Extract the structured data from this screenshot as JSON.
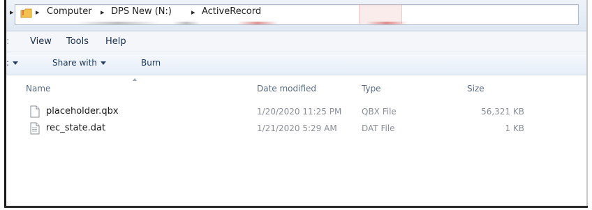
{
  "address_bar": {
    "crumbs": [
      "Computer",
      "DPS New (N:)",
      "ActiveRecord"
    ]
  },
  "menu": {
    "items": [
      "View",
      "Tools",
      "Help"
    ]
  },
  "toolbar": {
    "share_label": "Share with",
    "burn_label": "Burn"
  },
  "columns": {
    "name": "Name",
    "date": "Date modified",
    "type": "Type",
    "size": "Size"
  },
  "files": [
    {
      "name": "placeholder.qbx",
      "date": "1/20/2020 11:25 PM",
      "type": "QBX File",
      "size": "56,321 KB",
      "icon": "blank-file-icon"
    },
    {
      "name": "rec_state.dat",
      "date": "1/21/2020 5:29 AM",
      "type": "DAT File",
      "size": "1 KB",
      "icon": "text-file-icon"
    }
  ],
  "colors": {
    "menu_text": "#1b2f4a",
    "toolbar_text": "#1d3a63",
    "header_text": "#5a6b80",
    "detail_text": "#8a8f96"
  }
}
